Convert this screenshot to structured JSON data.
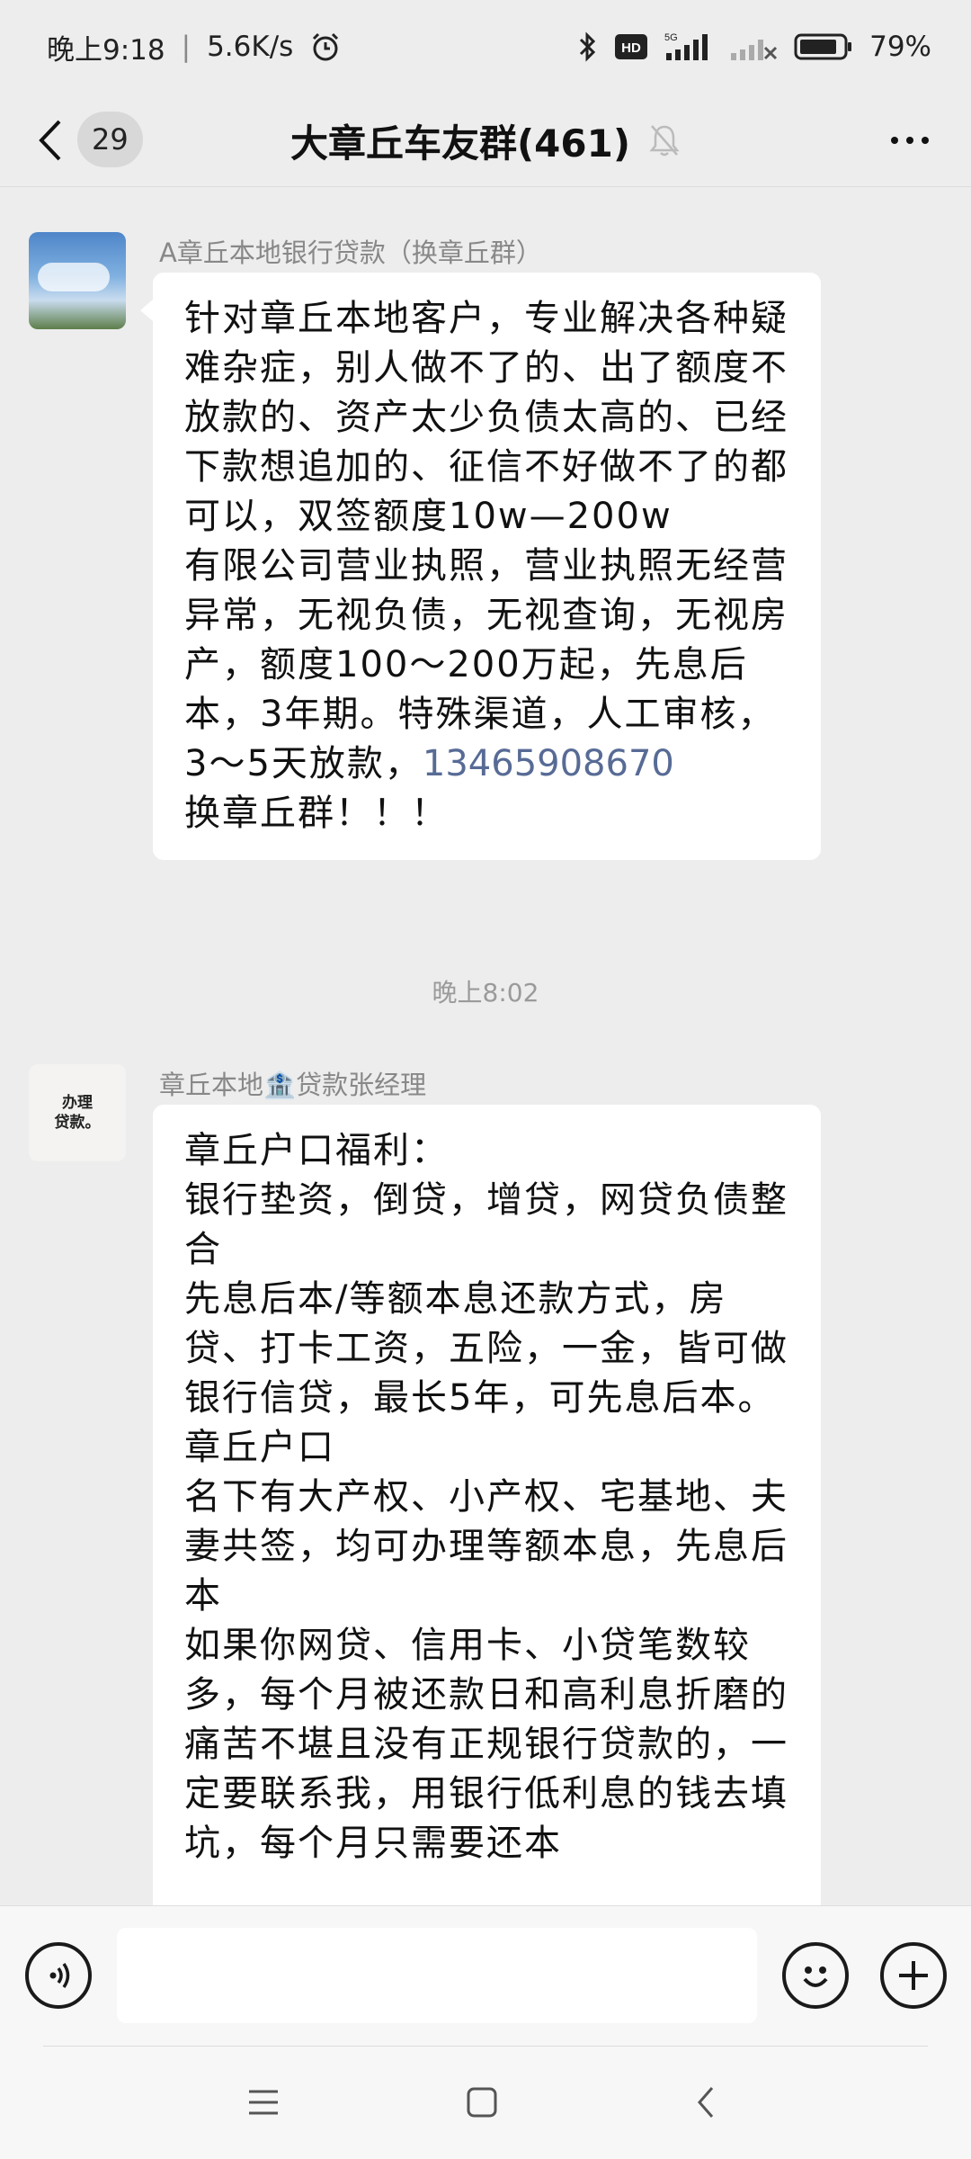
{
  "status_bar": {
    "time": "晚上9:18",
    "separator": "|",
    "net_speed": "5.6K/s",
    "battery": "79%",
    "hd_label": "HD",
    "signal_label": "5G",
    "icons": [
      "alarm-icon",
      "bluetooth-icon",
      "hd-icon",
      "signal-icon",
      "signal-no-service-icon",
      "battery-icon"
    ]
  },
  "header": {
    "unread_count": "29",
    "title": "大章丘车友群(461)",
    "muted_icon": "bell-off-icon"
  },
  "messages": [
    {
      "sender": "A章丘本地银行贷款（换章丘群）",
      "avatar": "sky-photo",
      "paragraphs": [
        "针对章丘本地客户，专业解决各种疑难杂症，别人做不了的、出了额度不放款的、资产太少负债太高的、已经下款想追加的、征信不好做不了的都可以，双签额度10w—200w",
        "有限公司营业执照，营业执照无经营异常，无视负债，无视查询，无视房产，额度100～200万起，先息后本，3年期。特殊渠道，人工审核，3～5天放款，",
        "换章丘群！！！"
      ],
      "phone": "13465908670"
    },
    {
      "sender": "章丘本地🏦贷款张经理",
      "avatar_text_line1": "办理",
      "avatar_text_line2": "贷款。",
      "paragraphs": [
        "章丘户口福利：",
        "银行垫资，倒贷，增贷，网贷负债整合",
        "先息后本/等额本息还款方式，房贷、打卡工资，五险，一金，皆可做银行信贷，最长5年，可先息后本。",
        "章丘户口",
        "名下有大产权、小产权、宅基地、夫妻共签，均可办理等额本息，先息后本",
        "如果你网贷、信用卡、小贷笔数较多，每个月被还款日和高利息折磨的痛苦不堪且没有正规银行贷款的，一定要联系我，用银行低利息的钱去填坑，每个月只需要还本"
      ]
    }
  ],
  "timestamp": "晚上8:02",
  "input_bar": {
    "placeholder": "",
    "voice_icon": "voice-icon",
    "emoji_icon": "emoji-icon",
    "plus_icon": "plus-icon"
  },
  "colors": {
    "background": "#ededed",
    "bubble": "#ffffff",
    "link": "#576b95",
    "meta_text": "#888888"
  }
}
